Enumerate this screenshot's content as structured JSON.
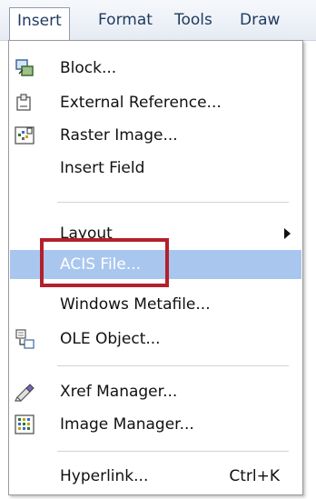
{
  "menubar": {
    "items": [
      {
        "label": "Insert"
      },
      {
        "label": "Format"
      },
      {
        "label": "Tools"
      },
      {
        "label": "Draw"
      }
    ]
  },
  "menu": {
    "block": "Block...",
    "external_reference": "External Reference...",
    "raster_image": "Raster Image...",
    "insert_field": "Insert Field",
    "layout": "Layout",
    "acis_file": "ACIS File...",
    "windows_metafile": "Windows Metafile...",
    "ole_object": "OLE Object...",
    "xref_manager": "Xref Manager...",
    "image_manager": "Image Manager...",
    "hyperlink": "Hyperlink...",
    "hyperlink_shortcut": "Ctrl+K"
  },
  "icons": {
    "block": "block-icon",
    "external_reference": "external-reference-icon",
    "raster_image": "raster-image-icon",
    "ole_object": "ole-object-icon",
    "xref_manager": "xref-manager-icon",
    "image_manager": "image-manager-icon"
  },
  "colors": {
    "highlight": "#a9c7ee",
    "callout": "#b3202b",
    "menubar_text": "#1e3a5f"
  }
}
